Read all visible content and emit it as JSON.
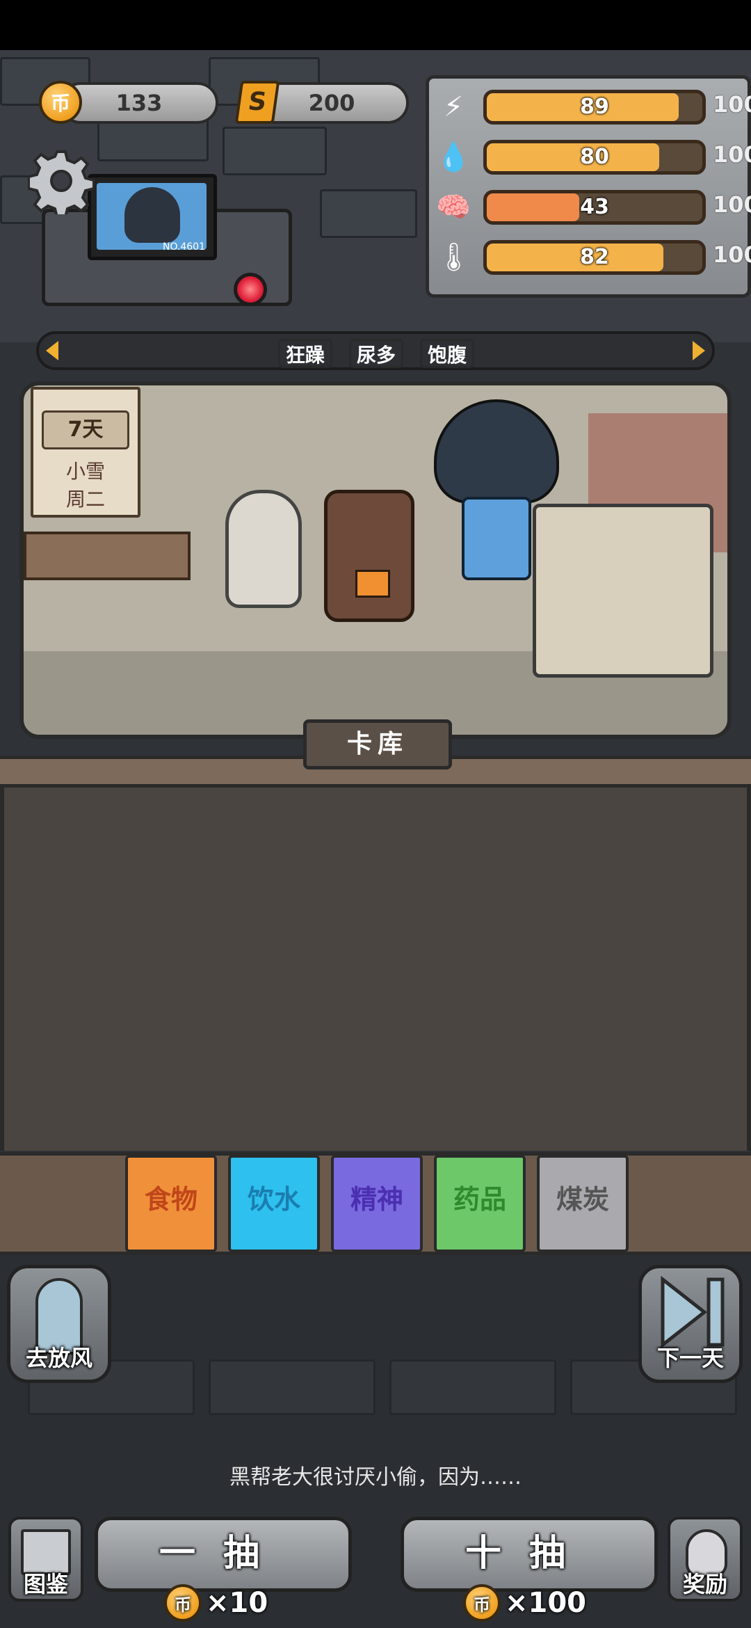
{
  "resources": {
    "coin_icon": "币",
    "coins": "133",
    "gem_icon": "S",
    "gems": "200"
  },
  "stats": [
    {
      "icon": "⚡",
      "icon_name": "energy-icon",
      "value": "89",
      "max": "100",
      "percent": 0.89,
      "color": "#f4b34a"
    },
    {
      "icon": "💧",
      "icon_name": "water-drop-icon",
      "value": "80",
      "max": "100",
      "percent": 0.8,
      "color": "#f4b34a"
    },
    {
      "icon": "🧠",
      "icon_name": "brain-icon",
      "value": "43",
      "max": "100",
      "percent": 0.43,
      "color": "#f08a4a"
    },
    {
      "icon": "🌡",
      "icon_name": "thermometer-icon",
      "value": "82",
      "max": "100",
      "percent": 0.82,
      "color": "#f4b34a"
    }
  ],
  "monitor": {
    "id_text": "NO.4601"
  },
  "status_tags": [
    {
      "label": "狂躁",
      "color": "#e0506a"
    },
    {
      "label": "尿多",
      "color": "#e0506a"
    },
    {
      "label": "饱腹",
      "color": "#4fae5a"
    }
  ],
  "calendar": {
    "day": "7天",
    "weather": "小雪",
    "weekday": "周二"
  },
  "card_panel": {
    "title": "卡库"
  },
  "categories": [
    {
      "label": "食物",
      "bg": "#f0903a",
      "fg": "#c0461a"
    },
    {
      "label": "饮水",
      "bg": "#2ec0ee",
      "fg": "#1a7db0"
    },
    {
      "label": "精神",
      "bg": "#7a6ae0",
      "fg": "#4b2fb0"
    },
    {
      "label": "药品",
      "bg": "#6dc86a",
      "fg": "#2f8a2e"
    },
    {
      "label": "煤炭",
      "bg": "#a9a9ae",
      "fg": "#555"
    }
  ],
  "buttons": {
    "go_out": "去放风",
    "next_day": "下一天",
    "draw_one": "一抽",
    "draw_ten": "十抽",
    "catalog": "图鉴",
    "reward": "奖励"
  },
  "costs": {
    "one": "×10",
    "ten": "×100"
  },
  "hint": "黑帮老大很讨厌小偷，因为……"
}
